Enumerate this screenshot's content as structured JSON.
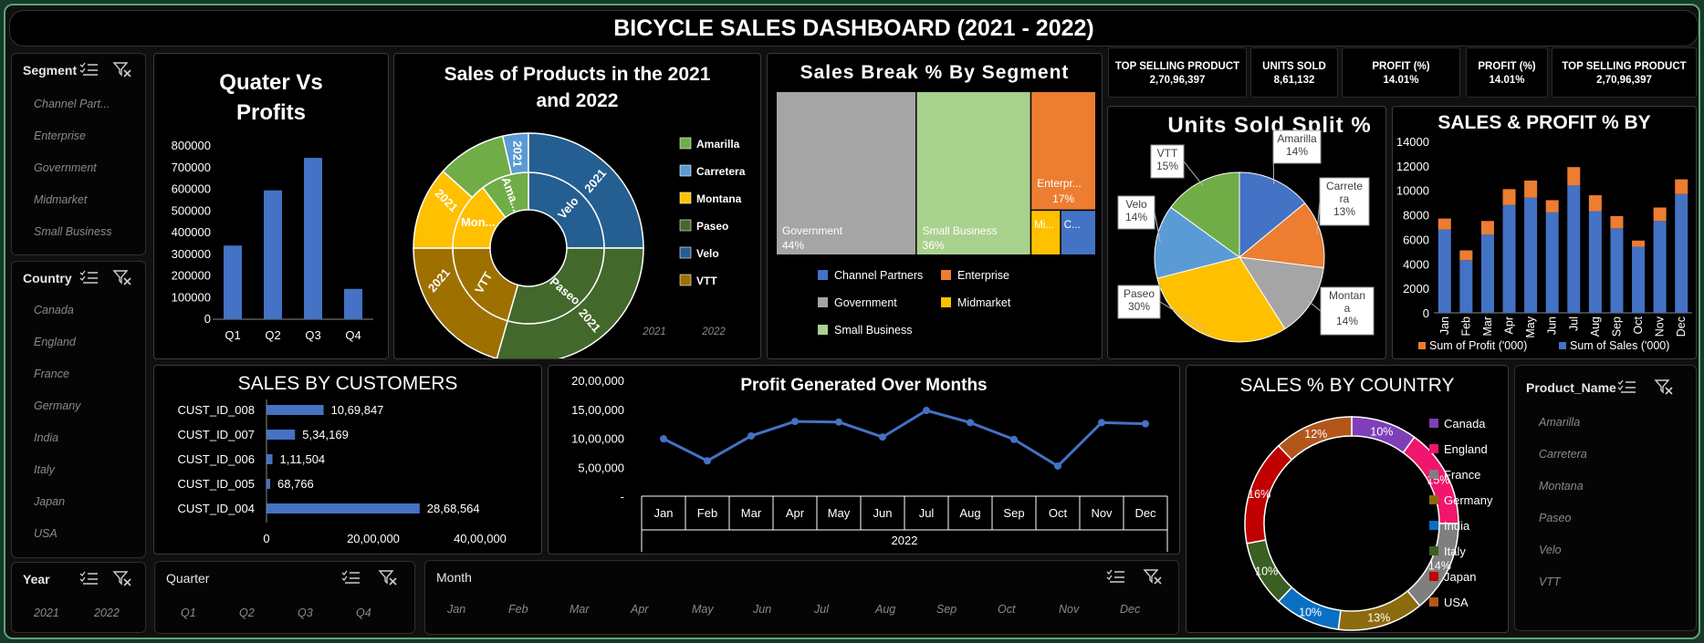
{
  "dashboard": {
    "title": "BICYCLE SALES DASHBOARD (2021 - 2022)"
  },
  "colors": {
    "accent_blue": "#4472C4",
    "frame_green": "#5fa27a",
    "orange": "#ED7D31",
    "gray": "#A5A5A5",
    "gold": "#FFC000",
    "green": "#70AD47",
    "dark_blue": "#255E91",
    "olive": "#9E7000",
    "dark_green": "#43682B"
  },
  "kpis": [
    {
      "label": "TOP SELLING PRODUCT",
      "value": "2,70,96,397"
    },
    {
      "label": "UNITS SOLD",
      "value": "8,61,132"
    },
    {
      "label": "PROFIT (%)",
      "value": "14.01%"
    },
    {
      "label": "PROFIT (%)",
      "value": "14.01%"
    },
    {
      "label": "TOP SELLING PRODUCT",
      "value": "2,70,96,397"
    }
  ],
  "slicers": {
    "segment": {
      "title": "Segment",
      "items": [
        "Channel Part...",
        "Enterprise",
        "Government",
        "Midmarket",
        "Small Business"
      ]
    },
    "country": {
      "title": "Country",
      "items": [
        "Canada",
        "England",
        "France",
        "Germany",
        "India",
        "Italy",
        "Japan",
        "USA"
      ]
    },
    "year": {
      "title": "Year",
      "items": [
        "2021",
        "2022"
      ]
    },
    "quarter": {
      "title": "Quarter",
      "items": [
        "Q1",
        "Q2",
        "Q3",
        "Q4"
      ]
    },
    "month": {
      "title": "Month",
      "items": [
        "Jan",
        "Feb",
        "Mar",
        "Apr",
        "May",
        "Jun",
        "Jul",
        "Aug",
        "Sep",
        "Oct",
        "Nov",
        "Dec"
      ]
    },
    "product": {
      "title": "Product_Name",
      "items": [
        "Amarilla",
        "Carretera",
        "Montana",
        "Paseo",
        "Velo",
        "VTT"
      ]
    }
  },
  "icons": {
    "multi_select": "multi-select-icon",
    "clear_filter": "clear-filter-icon"
  },
  "chart_data": [
    {
      "id": "quarter_profits",
      "type": "bar",
      "title_line1": "Quater Vs",
      "title_line2": "Profits",
      "categories": [
        "Q1",
        "Q2",
        "Q3",
        "Q4"
      ],
      "values": [
        340000,
        595000,
        745000,
        140000
      ],
      "ylim": [
        0,
        800000
      ],
      "yticks": [
        "800000",
        "700000",
        "600000",
        "500000",
        "400000",
        "300000",
        "200000",
        "100000",
        "0"
      ],
      "color": "#4472C4",
      "grid": false
    },
    {
      "id": "product_sunburst",
      "type": "pie",
      "title": "Sales of Products in the 2021 and 2022",
      "legend": [
        "Amarilla",
        "Carretera",
        "Montana",
        "Paseo",
        "Velo",
        "VTT"
      ],
      "legend_colors": [
        "#70AD47",
        "#5B9BD5",
        "#FFC000",
        "#43682B",
        "#255E91",
        "#9E7000"
      ],
      "years": [
        "2021",
        "2022"
      ],
      "year_share": [
        0.3,
        0.7
      ],
      "ring_labels": [
        "2021",
        "2021",
        "2021",
        "2021",
        "2021",
        "Velo",
        "Paseo",
        "VTT",
        "Mon...",
        "Ama..."
      ],
      "legend_position": "right"
    },
    {
      "id": "segment_treemap",
      "type": "heatmap",
      "title": "Sales Break % By Segment",
      "segments": [
        {
          "name": "Government",
          "value": 44,
          "label": "44%",
          "color": "#A5A5A5"
        },
        {
          "name": "Small Business",
          "value": 36,
          "label": "36%",
          "color": "#A9D18E"
        },
        {
          "name": "Enterprise",
          "short": "Enterpr...",
          "value": 17,
          "label": "17%",
          "color": "#ED7D31"
        },
        {
          "name": "Midmarket",
          "short": "Mi...",
          "value": 2,
          "color": "#FFC000"
        },
        {
          "name": "Channel Partners",
          "short": "C...",
          "value": 1,
          "color": "#4472C4"
        }
      ],
      "legend": [
        "Channel Partners",
        "Enterprise",
        "Government",
        "Midmarket",
        "Small Business"
      ],
      "legend_position": "bottom"
    },
    {
      "id": "units_split",
      "type": "pie",
      "title": "Units Sold Split %",
      "slices": [
        {
          "name": "Amarilla",
          "value": 14,
          "label": "14%",
          "color": "#4472C4"
        },
        {
          "name": "Carretera",
          "value": 13,
          "label": "13%",
          "color": "#ED7D31"
        },
        {
          "name": "Montana",
          "value": 14,
          "label": "14%",
          "color": "#A5A5A5"
        },
        {
          "name": "Paseo",
          "value": 30,
          "label": "30%",
          "color": "#FFC000"
        },
        {
          "name": "Velo",
          "value": 14,
          "label": "14%",
          "color": "#5B9BD5"
        },
        {
          "name": "VTT",
          "value": 15,
          "label": "15%",
          "color": "#70AD47"
        }
      ],
      "callouts": {
        "Amarilla": "Amarilla\n14%",
        "Carretera": "Carrete\nra\n13%",
        "Montana": "Montan\na\n14%",
        "Paseo": "Paseo\n30%",
        "Velo": "Velo\n14%",
        "VTT": "VTT\n15%"
      }
    },
    {
      "id": "sales_profit_month",
      "type": "bar",
      "title": "SALES & PROFIT % BY",
      "categories": [
        "Jan",
        "Feb",
        "Mar",
        "Apr",
        "May",
        "Jun",
        "Jul",
        "Aug",
        "Sep",
        "Oct",
        "Nov",
        "Dec"
      ],
      "series": [
        {
          "name": "Sum of Sales ('000)",
          "values": [
            6800,
            4300,
            6400,
            8800,
            9400,
            8200,
            10400,
            8300,
            6900,
            5400,
            7500,
            9700
          ],
          "color": "#4472C4"
        },
        {
          "name": "Sum of Profit ('000)",
          "values": [
            900,
            800,
            1100,
            1300,
            1400,
            1000,
            1500,
            1300,
            1000,
            500,
            1100,
            1200
          ],
          "color": "#ED7D31"
        }
      ],
      "stacked": true,
      "ylim": [
        0,
        14000
      ],
      "yticks": [
        "14000",
        "12000",
        "10000",
        "8000",
        "6000",
        "4000",
        "2000",
        "0"
      ],
      "legend_position": "bottom"
    },
    {
      "id": "sales_customers",
      "type": "bar",
      "orientation": "horizontal",
      "title": "SALES BY CUSTOMERS",
      "categories": [
        "CUST_ID_008",
        "CUST_ID_007",
        "CUST_ID_006",
        "CUST_ID_005",
        "CUST_ID_004"
      ],
      "values": [
        1069847,
        534169,
        111504,
        68766,
        2868564
      ],
      "value_labels": [
        "10,69,847",
        "5,34,169",
        "1,11,504",
        "68,766",
        "28,68,564"
      ],
      "xlim": [
        0,
        4000000
      ],
      "xticks": [
        "0",
        "20,00,000",
        "40,00,000"
      ],
      "color": "#4472C4"
    },
    {
      "id": "profit_months",
      "type": "line",
      "title": "Profit Generated Over Months",
      "categories": [
        "Jan",
        "Feb",
        "Mar",
        "Apr",
        "May",
        "Jun",
        "Jul",
        "Aug",
        "Sep",
        "Oct",
        "Nov",
        "Dec"
      ],
      "values": [
        990000,
        610000,
        1040000,
        1290000,
        1280000,
        1020000,
        1480000,
        1270000,
        980000,
        520000,
        1270000,
        1250000
      ],
      "ylim": [
        0,
        2000000
      ],
      "yticks": [
        "20,00,000",
        "15,00,000",
        "10,00,000",
        "5,00,000",
        "-"
      ],
      "group_label": "2022",
      "color": "#4472C4"
    },
    {
      "id": "country_donut",
      "type": "pie",
      "title": "SALES % BY COUNTRY",
      "slices": [
        {
          "name": "Canada",
          "value": 10,
          "label": "10%",
          "color": "#7E3FB8"
        },
        {
          "name": "England",
          "value": 15,
          "label": "15%",
          "color": "#F0166D"
        },
        {
          "name": "France",
          "value": 14,
          "label": "14%",
          "color": "#7F7F7F"
        },
        {
          "name": "Germany",
          "value": 13,
          "label": "13%",
          "color": "#8C6A0E"
        },
        {
          "name": "India",
          "value": 10,
          "label": "10%",
          "color": "#0A6FC2"
        },
        {
          "name": "Italy",
          "value": 10,
          "label": "10%",
          "color": "#3B5E23"
        },
        {
          "name": "Japan",
          "value": 16,
          "label": "16%",
          "color": "#C00000"
        },
        {
          "name": "USA",
          "value": 12,
          "label": "12%",
          "color": "#B3561C"
        }
      ],
      "legend_position": "right"
    }
  ]
}
